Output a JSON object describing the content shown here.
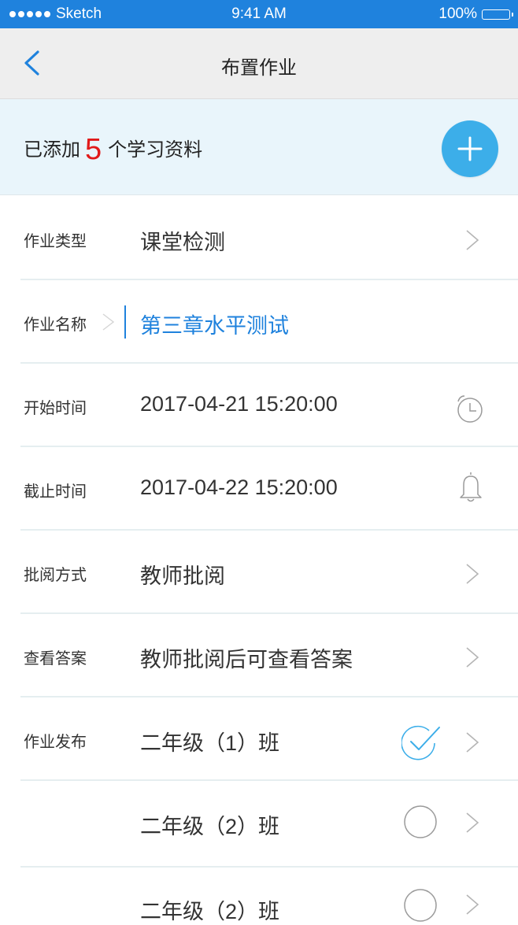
{
  "status_bar": {
    "carrier": "Sketch",
    "time": "9:41 AM",
    "battery": "100%"
  },
  "nav": {
    "title": "布置作业",
    "back_icon": "chevron-left-icon"
  },
  "banner": {
    "prefix": "已添加",
    "count": "5",
    "suffix": "个学习资料",
    "add_icon": "plus-icon"
  },
  "colors": {
    "accent": "#1f82dd",
    "add_button": "#3caee9",
    "count_red": "#e11a1a",
    "banner_bg": "#e9f5fb"
  },
  "form": {
    "type": {
      "label": "作业类型",
      "value": "课堂检测"
    },
    "name": {
      "label": "作业名称",
      "value": "第三章水平测试"
    },
    "start": {
      "label": "开始时间",
      "value": "2017-04-21 15:20:00",
      "icon": "alarm-clock-icon"
    },
    "deadline": {
      "label": "截止时间",
      "value": "2017-04-22 15:20:00",
      "icon": "bell-icon"
    },
    "review": {
      "label": "批阅方式",
      "value": "教师批阅"
    },
    "answers": {
      "label": "查看答案",
      "value": "教师批阅后可查看答案"
    },
    "publish": {
      "label": "作业发布",
      "classes": [
        {
          "name": "二年级（1）班",
          "checked": true
        },
        {
          "name": "二年级（2）班",
          "checked": false
        },
        {
          "name": "二年级（2）班",
          "checked": false
        }
      ]
    }
  }
}
